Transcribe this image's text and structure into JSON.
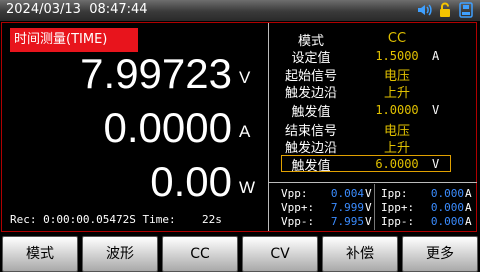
{
  "status": {
    "datetime": "2024/03/13  08:47:44",
    "icons": [
      "speaker-icon",
      "unlock-icon",
      "save-icon"
    ],
    "icon_colors": {
      "speaker": "#3fa0ff",
      "lock": "#f5c400",
      "save": "#3fa0ff"
    }
  },
  "left": {
    "mode_badge": "时间测量(TIME)",
    "voltage": "7.99723",
    "voltage_unit": "V",
    "current": "0.0000",
    "current_unit": "A",
    "power": "0.00",
    "power_unit": "W",
    "rec_line": "Rec: 0:00:00.05472S Time:    22s"
  },
  "right": {
    "rows": [
      {
        "label": "模式",
        "value": "CC",
        "unit": ""
      },
      {
        "label": "设定值",
        "value": "1.5000",
        "unit": "A"
      },
      {
        "label": "起始信号",
        "value": "电压",
        "unit": ""
      },
      {
        "label": "触发边沿",
        "value": "上升",
        "unit": ""
      },
      {
        "label": "触发值",
        "value": "1.0000",
        "unit": "V"
      },
      {
        "label": "结束信号",
        "value": "电压",
        "unit": ""
      },
      {
        "label": "触发边沿",
        "value": "上升",
        "unit": ""
      },
      {
        "label": "触发值",
        "value": "6.0000",
        "unit": "V"
      }
    ]
  },
  "stats": {
    "vpp_label": "Vpp:",
    "vpp": "0.004",
    "vpp_unit": "V",
    "vppp_label": "Vpp+:",
    "vppp": "7.999",
    "vppp_unit": "V",
    "vppm_label": "Vpp-:",
    "vppm": "7.995",
    "vppm_unit": "V",
    "ipp_label": "Ipp:",
    "ipp": "0.000",
    "ipp_unit": "A",
    "ippp_label": "Ipp+:",
    "ippp": "0.000",
    "ippp_unit": "A",
    "ippm_label": "Ipp-:",
    "ippm": "0.000",
    "ippm_unit": "A"
  },
  "softkeys": [
    "模式",
    "波形",
    "CC",
    "CV",
    "补偿",
    "更多"
  ],
  "colors": {
    "accent_red": "#e8141c",
    "value_yellow": "#e0c000",
    "stat_blue": "#3b8cff",
    "frame_red": "#b00000"
  }
}
